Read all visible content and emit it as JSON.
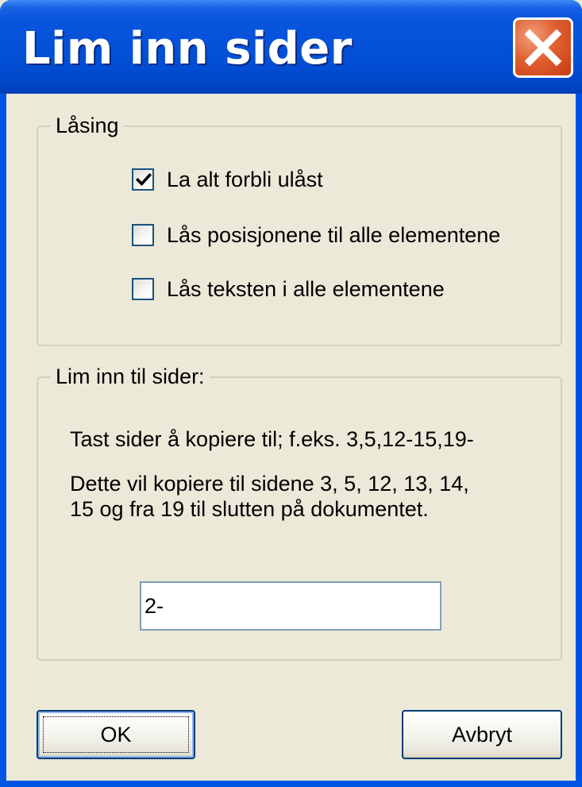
{
  "window": {
    "title": "Lim inn sider",
    "close_icon": "close-icon",
    "colors": {
      "titlebar": "#0054e3",
      "close_button": "#e06030",
      "face": "#ece9d8"
    }
  },
  "locking_group": {
    "title": "Låsing",
    "options": [
      {
        "label": "La alt forbli ulåst",
        "checked": true
      },
      {
        "label": "Lås posisjonene til alle elementene",
        "checked": false
      },
      {
        "label": "Lås teksten i alle elementene",
        "checked": false
      }
    ]
  },
  "paste_group": {
    "title": "Lim inn til sider:",
    "instruction": "Tast sider å kopiere til; f.eks. 3,5,12-15,19-",
    "explanation_line1": "Dette vil kopiere til sidene 3, 5, 12, 13, 14,",
    "explanation_line2": "15 og fra 19 til slutten på dokumentet.",
    "pages_value": "2-"
  },
  "buttons": {
    "ok_label": "OK",
    "cancel_label": "Avbryt"
  }
}
